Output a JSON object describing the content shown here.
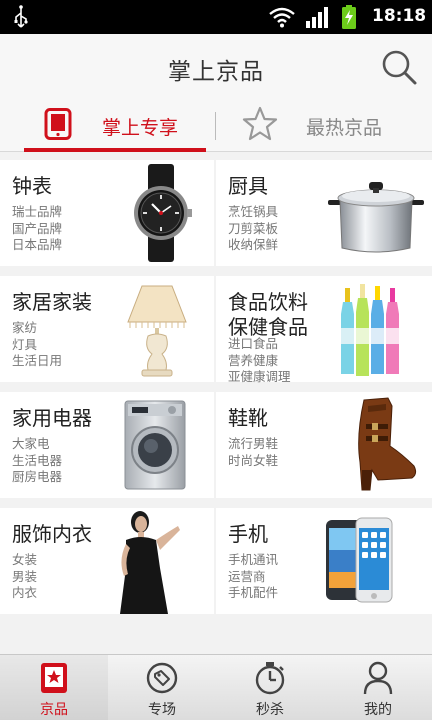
{
  "status_bar": {
    "time": "18:18"
  },
  "header": {
    "title": "掌上京品"
  },
  "tabs": [
    {
      "label": "掌上专享",
      "active": true,
      "icon": "tablet-icon"
    },
    {
      "label": "最热京品",
      "active": false,
      "icon": "star-icon"
    }
  ],
  "categories": [
    {
      "title": "钟表",
      "subs": [
        "瑞士品牌",
        "国产品牌",
        "日本品牌"
      ],
      "image": "watch"
    },
    {
      "title": "厨具",
      "subs": [
        "烹饪锅具",
        "刀剪菜板",
        "收纳保鲜"
      ],
      "image": "cooking-pot"
    },
    {
      "title": "家居家装",
      "subs": [
        "家纺",
        "灯具",
        "生活日用"
      ],
      "image": "table-lamp"
    },
    {
      "title": "食品饮料\n保健食品",
      "subs": [
        "进口食品",
        "营养健康",
        "亚健康调理"
      ],
      "image": "drink-bottles"
    },
    {
      "title": "家用电器",
      "subs": [
        "大家电",
        "生活电器",
        "厨房电器"
      ],
      "image": "washing-machine"
    },
    {
      "title": "鞋靴",
      "subs": [
        "流行男鞋",
        "时尚女鞋"
      ],
      "image": "boot"
    },
    {
      "title": "服饰内衣",
      "subs": [
        "女装",
        "男装",
        "内衣"
      ],
      "image": "model-dress"
    },
    {
      "title": "手机",
      "subs": [
        "手机通讯",
        "运营商",
        "手机配件"
      ],
      "image": "smartphones"
    }
  ],
  "bottom_nav": [
    {
      "label": "京品",
      "active": true,
      "icon": "jingpin-icon"
    },
    {
      "label": "专场",
      "active": false,
      "icon": "tag-icon"
    },
    {
      "label": "秒杀",
      "active": false,
      "icon": "stopwatch-icon"
    },
    {
      "label": "我的",
      "active": false,
      "icon": "user-icon"
    }
  ],
  "colors": {
    "accent": "#d0101b",
    "background": "#f2f2f2",
    "status_bar": "#000000"
  }
}
